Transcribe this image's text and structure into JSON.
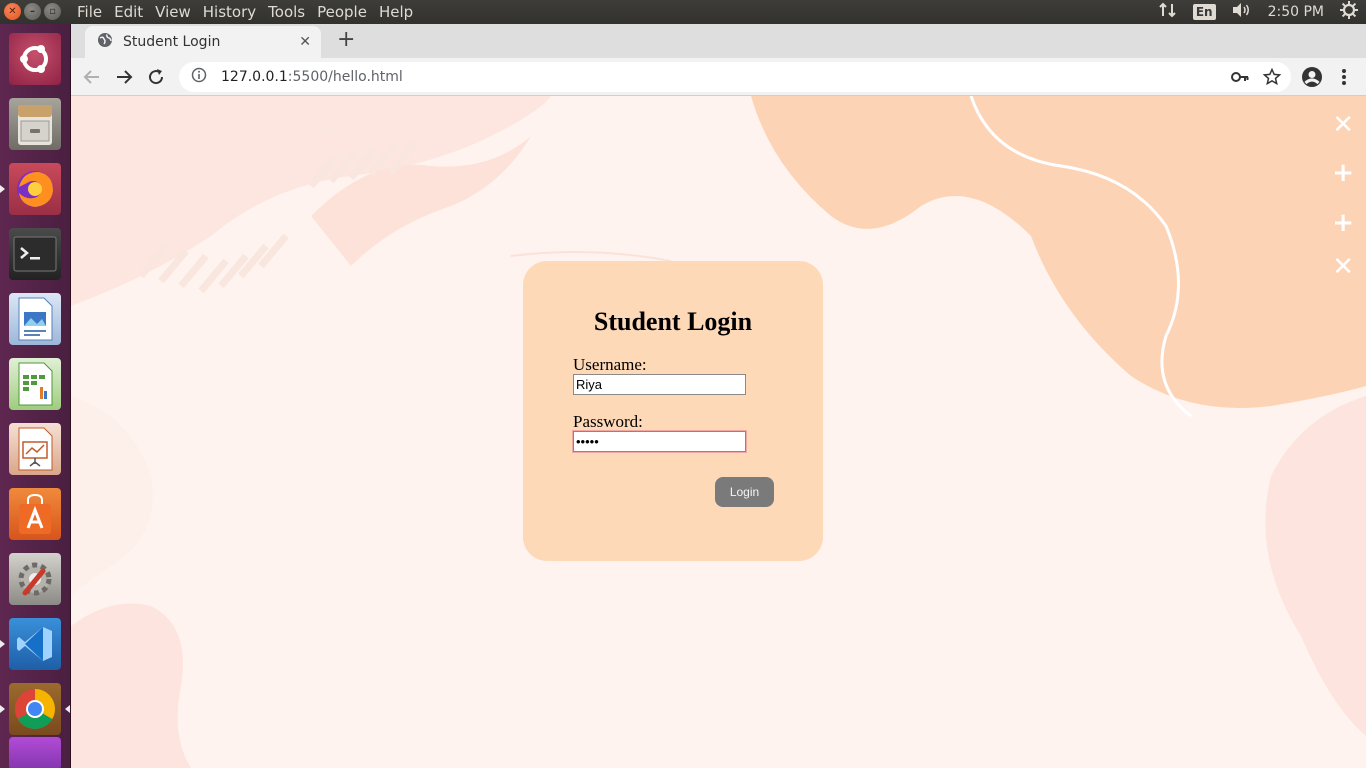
{
  "top_panel": {
    "menu": [
      "File",
      "Edit",
      "View",
      "History",
      "Tools",
      "People",
      "Help"
    ],
    "keyboard_layout": "En",
    "clock": "2:50 PM"
  },
  "launcher": {
    "apps": [
      "ubuntu-dash",
      "files",
      "firefox",
      "terminal",
      "libreoffice-writer",
      "libreoffice-calc",
      "libreoffice-impress",
      "ubuntu-software",
      "system-settings",
      "vscode",
      "chrome",
      "app-partial"
    ]
  },
  "browser": {
    "tab_title": "Student Login",
    "url_host": "127.0.0.1",
    "url_rest": ":5500/hello.html"
  },
  "page": {
    "title": "Student Login",
    "username_label": "Username:",
    "username_value": "Riya",
    "password_label": "Password:",
    "password_value": "•••••",
    "login_button": "Login"
  },
  "colors": {
    "card": "#fdd9b8",
    "page_bg": "#fef3ee",
    "blob": "#fdd3b5",
    "button": "#7a7a7a"
  },
  "side_icons": [
    "close-icon",
    "plus-icon",
    "plus-icon",
    "close-icon"
  ]
}
